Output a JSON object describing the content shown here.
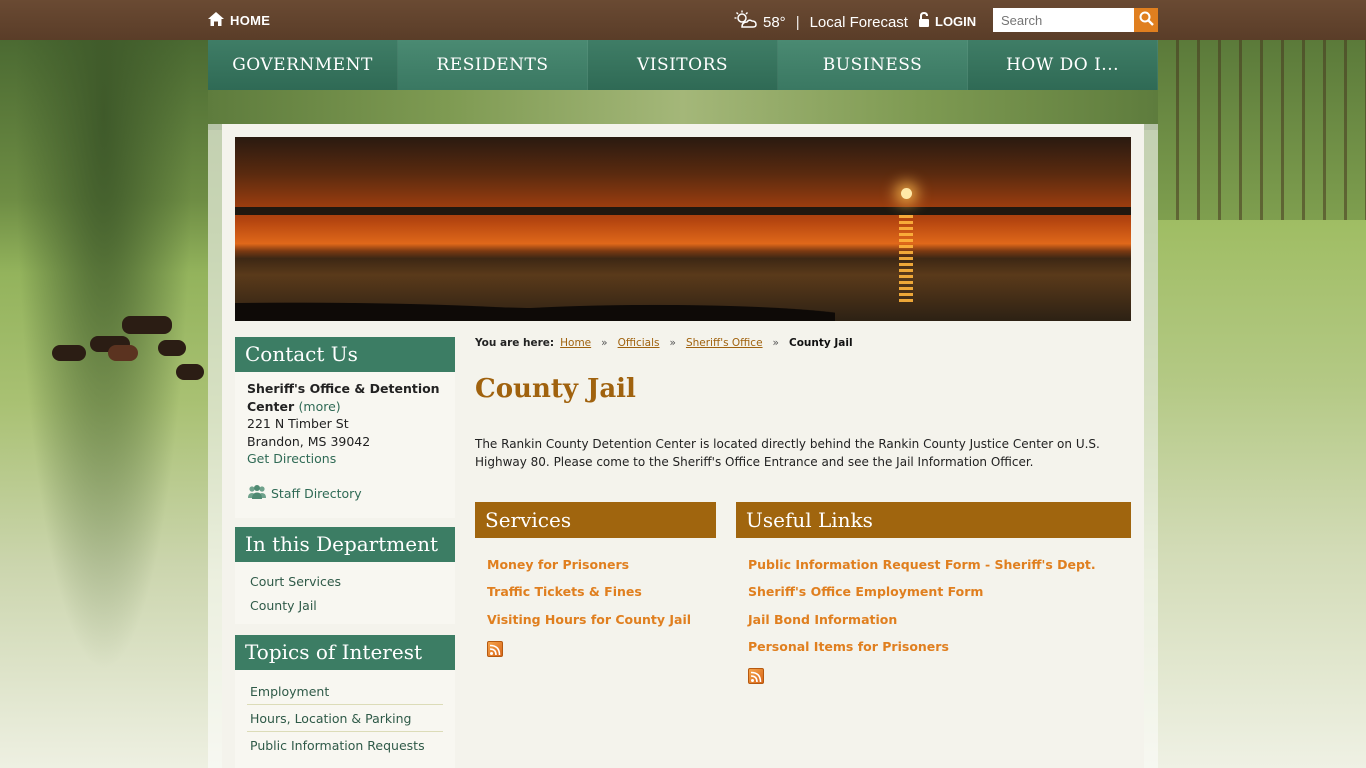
{
  "topbar": {
    "home_label": "HOME",
    "weather_temp": "58°",
    "forecast_label": "Local Forecast",
    "login_label": "LOGIN",
    "search_placeholder": "Search"
  },
  "nav": {
    "items": [
      {
        "label": "GOVERNMENT"
      },
      {
        "label": "RESIDENTS"
      },
      {
        "label": "VISITORS"
      },
      {
        "label": "BUSINESS"
      },
      {
        "label": "HOW DO I..."
      }
    ]
  },
  "sidebar": {
    "contact": {
      "heading": "Contact Us",
      "name": "Sheriff's Office & Detention Center",
      "more_label": "(more)",
      "street": "221 N Timber St",
      "city": "Brandon, MS 39042",
      "directions_label": "Get Directions",
      "staff_label": "Staff Directory"
    },
    "department": {
      "heading": "In this Department",
      "items": [
        {
          "label": "Court Services"
        },
        {
          "label": "County Jail"
        }
      ]
    },
    "topics": {
      "heading": "Topics of Interest",
      "items": [
        {
          "label": "Employment"
        },
        {
          "label": "Hours, Location & Parking"
        },
        {
          "label": "Public Information Requests"
        }
      ]
    }
  },
  "breadcrumb": {
    "label": "You are here:",
    "items": [
      {
        "label": "Home"
      },
      {
        "label": "Officials"
      },
      {
        "label": "Sheriff's Office"
      }
    ],
    "separator": "»",
    "current": "County Jail"
  },
  "main": {
    "title": "County Jail",
    "intro": "The Rankin County Detention Center is located directly behind the Rankin County Justice Center on U.S. Highway 80. Please come to the Sheriff's Office Entrance and see the Jail Information Officer.",
    "services": {
      "heading": "Services",
      "links": [
        {
          "label": "Money for Prisoners"
        },
        {
          "label": "Traffic Tickets & Fines"
        },
        {
          "label": "Visiting Hours for County Jail"
        }
      ]
    },
    "useful_links": {
      "heading": "Useful Links",
      "links": [
        {
          "label": "Public Information Request Form - Sheriff's Dept."
        },
        {
          "label": "Sheriff's Office Employment Form"
        },
        {
          "label": "Jail Bond Information"
        },
        {
          "label": "Personal Items for Prisoners"
        }
      ]
    }
  },
  "colors": {
    "topbar": "#5a3d28",
    "nav_green": "#3c7d64",
    "accent_brown": "#a0650e",
    "accent_orange": "#e07f1f",
    "content_bg": "#f4f3ec"
  }
}
